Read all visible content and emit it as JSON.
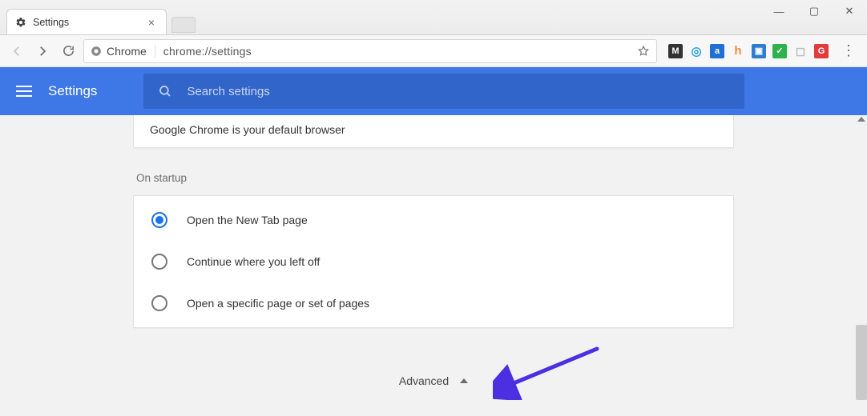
{
  "window": {
    "tab_title": "Settings",
    "minimize": "—",
    "maximize": "▢",
    "close": "✕"
  },
  "omnibar": {
    "chip_label": "Chrome",
    "url": "chrome://settings",
    "ext_icons": [
      "M",
      "◎",
      "a",
      "h",
      "▣",
      "✓",
      "◻",
      "G"
    ],
    "ext_colors": [
      "#333333",
      "#2aa3e0",
      "#1f6fd6",
      "#ef8a3d",
      "#2d7dd2",
      "#2fb24c",
      "#bdbdbd",
      "#e23b3b"
    ]
  },
  "header": {
    "title": "Settings",
    "search_placeholder": "Search settings"
  },
  "default_browser": {
    "message": "Google Chrome is your default browser"
  },
  "startup": {
    "section_label": "On startup",
    "options": [
      {
        "label": "Open the New Tab page",
        "selected": true
      },
      {
        "label": "Continue where you left off",
        "selected": false
      },
      {
        "label": "Open a specific page or set of pages",
        "selected": false
      }
    ]
  },
  "advanced": {
    "label": "Advanced"
  },
  "annotation": {
    "color": "#4b2fe0"
  }
}
